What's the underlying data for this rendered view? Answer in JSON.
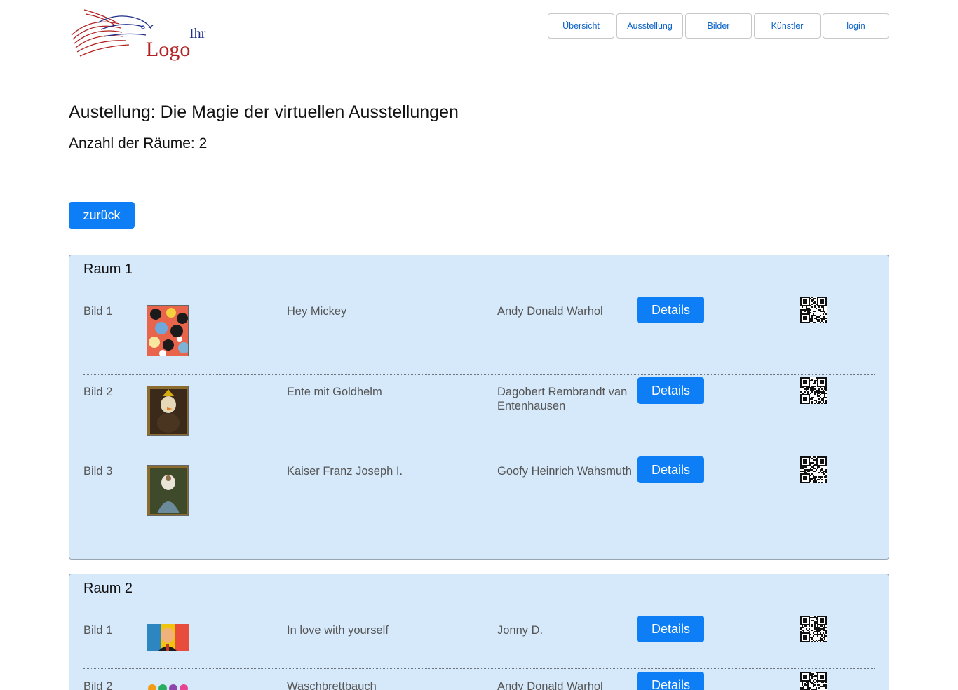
{
  "logo": {
    "text_main": "Logo",
    "text_small": "Ihr"
  },
  "nav": {
    "items": [
      "Übersicht",
      "Ausstellung",
      "Bilder",
      "Künstler",
      "login"
    ]
  },
  "page": {
    "title": "Austellung: Die Magie der virtuellen Ausstellungen",
    "rooms_count": "Anzahl der Räume: 2",
    "back_label": "zurück"
  },
  "rooms": [
    {
      "title": "Raum 1",
      "items": [
        {
          "label": "Bild 1",
          "title": "Hey Mickey",
          "artist": "Andy Donald Warhol",
          "details": "Details",
          "thumb": "mickey-collage"
        },
        {
          "label": "Bild 2",
          "title": "Ente mit Goldhelm",
          "artist": "Dagobert Rembrandt van Entenhausen",
          "details": "Details",
          "thumb": "duck-portrait"
        },
        {
          "label": "Bild 3",
          "title": "Kaiser Franz Joseph I.",
          "artist": "Goofy Heinrich Wahsmuth",
          "details": "Details",
          "thumb": "emperor-portrait"
        }
      ]
    },
    {
      "title": "Raum 2",
      "items": [
        {
          "label": "Bild 1",
          "title": "In love with yourself",
          "artist": "Jonny D.",
          "details": "Details",
          "thumb": "popart-portrait"
        },
        {
          "label": "Bild 2",
          "title": "Waschbrettbauch",
          "artist": "Andy Donald Warhol",
          "details": "Details",
          "thumb": "popart-figures"
        }
      ]
    }
  ],
  "colors": {
    "primary": "#0d7ef5",
    "room_bg": "#d6e9fb",
    "nav_text": "#0b63c8",
    "logo_red": "#b22222",
    "logo_blue": "#1f2f8a"
  }
}
